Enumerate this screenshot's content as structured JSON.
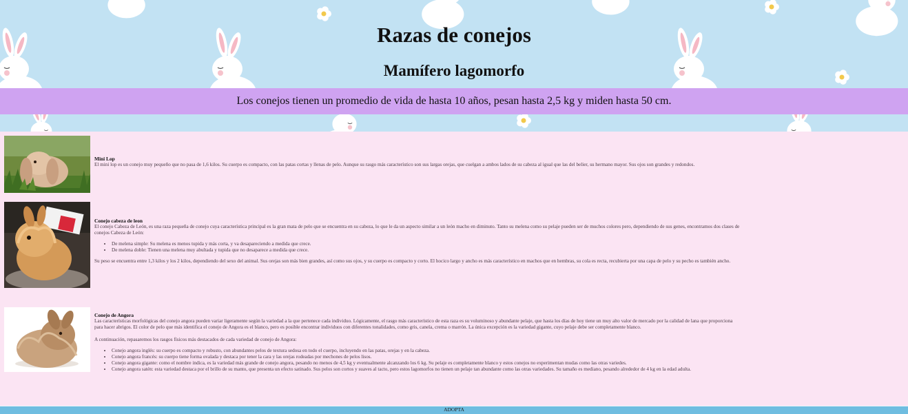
{
  "header": {
    "title": "Razas de conejos",
    "subtitle": "Mamífero lagomorfo",
    "band_text": "Los conejos tienen un promedio de vida de hasta 10 años, pesan hasta 2,5 kg y miden hasta 50 cm."
  },
  "colors": {
    "hero_bg": "#c2e2f3",
    "band_bg": "#cfa3f1",
    "content_bg": "#fbe4f3",
    "footer_bg": "#6fbde0"
  },
  "breeds": [
    {
      "name": "Mini Lop",
      "paragraphs": [
        "El mini lop es un conejo muy pequeño que no pasa de 1,6 kilos. Su cuerpo es compacto, con las patas cortas y llenas de pelo. Aunque su rasgo más característico son sus largas orejas, que cuelgan a ambos lados de su cabeza al igual que las del belier, su hermano mayor. Sus ojos son grandes y redondos."
      ]
    },
    {
      "name": "Conejo cabeza de leon",
      "intro": "El conejo Cabeza de León, es una raza pequeña de conejo cuya característica principal es la gran mata de pelo que se encuentra en su cabeza, lo que le da un aspecto similar a un león macho en diminuto. Tanto su melena como su pelaje pueden ser de muchos colores pero, dependiendo de sus genes, encontramos dos clases de conejos Cabeza de León:",
      "list": [
        "De melena simple: Su melena es menos tupida y más corta, y va desapareciendo a medida que crece.",
        "De melena doble: Tienen una melena muy abultada y tupida que no desaparece a medida que crece."
      ],
      "outro": "Su peso se encuentra entre 1,3 kilos y los 2 kilos, dependiendo del sexo del animal. Sus orejas son más bien grandes, así como sus ojos, y su cuerpo es compacto y corto. El hocico largo y ancho es más característico en machos que en hembras, su cola es recta, recubierta por una capa de pelo y su pecho es también ancho."
    },
    {
      "name": "Conejo de Angora",
      "intro": "Las características morfológicas del conejo angora pueden variar ligeramente según la variedad a la que pertenece cada individuo. Lógicamente, el rasgo más característico de esta raza es su voluminoso y abundante pelaje, que hasta los días de hoy tiene un muy alto valor de mercado por la calidad de lana que proporciona para hacer abrigos. El color de pelo que más identifica el conejo de Angora es el blanco, pero es posible encontrar individuos con diferentes tonalidades, como gris, canela, crema o marrón. La única excepción es la variedad gigante, cuyo pelaje debe ser completamente blanco.",
      "intro2": "A continuación, repasaremos los rasgos físicos más destacados de cada variedad de conejo de Angora:",
      "list": [
        "Conejo angora inglés: su cuerpo es compacto y robusto, con abundantes pelos de textura sedosa en todo el cuerpo, incluyendo en las patas, orejas y en la cabeza.",
        "Conejo angora francés: su cuerpo tiene forma ovalada y destaca por tener la cara y las orejas rodeadas por mechones de pelos lisos.",
        "Conejo angora gigante: como el nombre indica, es la variedad más grande de conejo angora, pesando no menos de 4,5 kg y eventualmente alcanzando los 6 kg. Su pelaje es completamente blanco y estos conejos no experimentan mudas como las otras variedes.",
        "Conejo angora satén: esta variedad destaca por el brillo de su manto, que presenta un efecto satinado. Sus pelos son cortos y suaves al tacto, pero estos lagomorfos no tienen un pelaje tan abundante como las otras variedades. Su tamaño es mediano, pesando alrededor de 4 kg en la edad adulta."
      ]
    }
  ],
  "footer": {
    "text": "ADOPTA"
  }
}
